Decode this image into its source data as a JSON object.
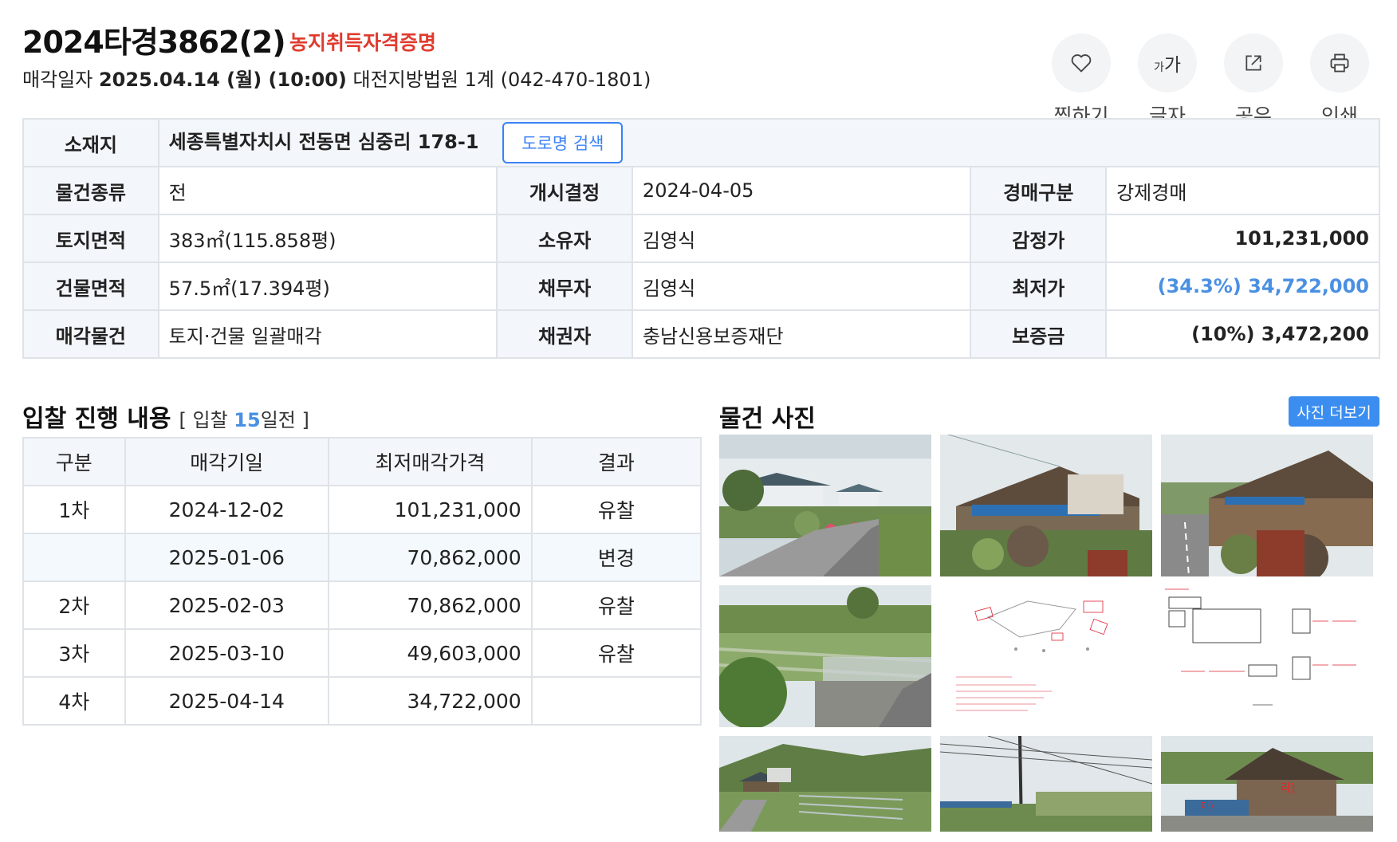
{
  "header": {
    "case_number": "2024타경3862(2)",
    "farm_badge": "농지취득자격증명",
    "sale_prefix": "매각일자",
    "sale_date": "2025.04.14 (월) (10:00)",
    "court": "대전지방법원 1계 (042-470-1801)"
  },
  "actions": [
    {
      "label": "찜하기",
      "icon": "heart-icon"
    },
    {
      "label": "글자",
      "icon": "font-size-icon",
      "glyph_small": "가",
      "glyph_large": "가"
    },
    {
      "label": "공유",
      "icon": "share-icon"
    },
    {
      "label": "인쇄",
      "icon": "print-icon"
    }
  ],
  "info": {
    "location_label": "소재지",
    "location": "세종특별자치시 전동면 심중리 178-1",
    "road_search": "도로명 검색",
    "rows": [
      {
        "l1": "물건종류",
        "v1": "전",
        "l2": "개시결정",
        "v2": "2024-04-05",
        "l3": "경매구분",
        "v3": "강제경매"
      },
      {
        "l1": "토지면적",
        "v1": "383㎡(115.858평)",
        "l2": "소유자",
        "v2": "김영식",
        "l3": "감정가",
        "v3": "101,231,000"
      },
      {
        "l1": "건물면적",
        "v1": "57.5㎡(17.394평)",
        "l2": "채무자",
        "v2": "김영식",
        "l3": "최저가",
        "v3": "(34.3%) 34,722,000"
      },
      {
        "l1": "매각물건",
        "v1": "토지·건물 일괄매각",
        "l2": "채권자",
        "v2": "충남신용보증재단",
        "l3": "보증금",
        "v3": "(10%) 3,472,200"
      }
    ]
  },
  "bids": {
    "title": "입찰 진행 내용",
    "sub_prefix": "[ 입찰",
    "sub_count": "15",
    "sub_suffix": "일전 ]",
    "headers": [
      "구분",
      "매각기일",
      "최저매각가격",
      "결과"
    ],
    "rows": [
      {
        "round": "1차",
        "date": "2024-12-02",
        "price": "101,231,000",
        "result": "유찰"
      },
      {
        "round": "",
        "date": "2025-01-06",
        "price": "70,862,000",
        "result": "변경"
      },
      {
        "round": "2차",
        "date": "2025-02-03",
        "price": "70,862,000",
        "result": "유찰"
      },
      {
        "round": "3차",
        "date": "2025-03-10",
        "price": "49,603,000",
        "result": "유찰"
      },
      {
        "round": "4차",
        "date": "2025-04-14",
        "price": "34,722,000",
        "result": ""
      }
    ]
  },
  "photos": {
    "title": "물건 사진",
    "more": "사진 더보기",
    "items": [
      "road-house-photo",
      "shed-photo-1",
      "shed-photo-2",
      "field-photo",
      "site-plan-drawing",
      "structure-diagram",
      "village-photo",
      "powerline-photo",
      "shed-front-photo"
    ]
  },
  "colors": {
    "accent_blue": "#4a90e2",
    "badge_red": "#e03b2e",
    "table_border": "#dfe3e8",
    "header_bg": "#f3f6fa"
  }
}
